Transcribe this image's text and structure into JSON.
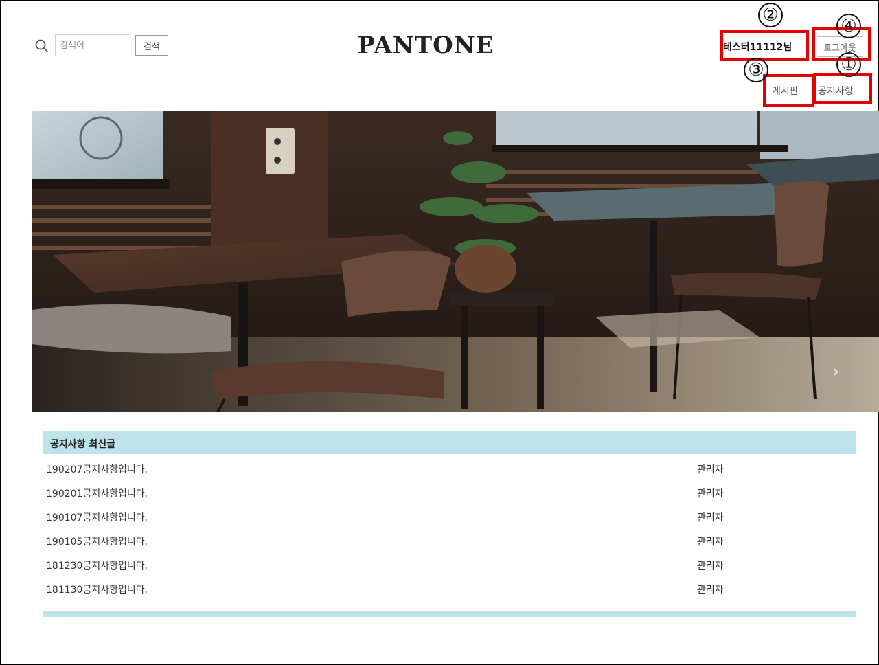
{
  "header": {
    "logo": "PANTONE",
    "search": {
      "placeholder": "검색어",
      "button_label": "검색"
    },
    "user": {
      "name": "테스터11112님",
      "logout_label": "로그아웃"
    }
  },
  "nav": {
    "board_label": "게시판",
    "notice_label": "공지사항"
  },
  "annotations": [
    "①",
    "②",
    "③",
    "④"
  ],
  "hero": {
    "next_arrow": "›"
  },
  "notice_section": {
    "title": "공지사항 최신글",
    "rows": [
      {
        "title": "190207공지사항입니다.",
        "author": "관리자"
      },
      {
        "title": "190201공지사항입니다.",
        "author": "관리자"
      },
      {
        "title": "190107공지사항입니다.",
        "author": "관리자"
      },
      {
        "title": "190105공지사항입니다.",
        "author": "관리자"
      },
      {
        "title": "181230공지사항입니다.",
        "author": "관리자"
      },
      {
        "title": "181130공지사항입니다.",
        "author": "관리자"
      }
    ]
  },
  "colors": {
    "annotation_red": "#e50000",
    "table_header_bg": "#bfe3ea"
  }
}
